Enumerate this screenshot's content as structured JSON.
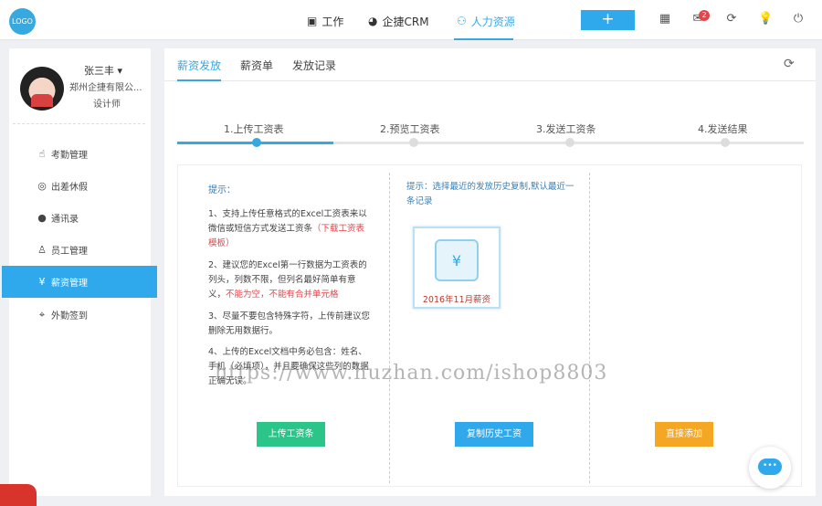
{
  "header": {
    "logo": "LOGO",
    "nav": [
      {
        "label": "工作",
        "icon": "briefcase-icon"
      },
      {
        "label": "企捷CRM",
        "icon": "pie-chart-icon"
      },
      {
        "label": "人力资源",
        "icon": "people-icon"
      }
    ],
    "add_label": "+",
    "badge_count": "2",
    "accent": "#2fa8ec"
  },
  "sidebar": {
    "user_name": "张三丰 ▾",
    "company": "郑州企捷有限公...",
    "position": "设计师",
    "items": [
      {
        "label": "考勤管理",
        "icon": "hand-icon"
      },
      {
        "label": "出差休假",
        "icon": "location-icon"
      },
      {
        "label": "通讯录",
        "icon": "contact-icon"
      },
      {
        "label": "员工管理",
        "icon": "staff-icon"
      },
      {
        "label": "薪资管理",
        "icon": "yen-icon"
      },
      {
        "label": "外勤签到",
        "icon": "pin-icon"
      }
    ]
  },
  "tabs": [
    "薪资发放",
    "薪资单",
    "发放记录"
  ],
  "steps": [
    "1.上传工资表",
    "2.预览工资表",
    "3.发送工资条",
    "4.发送结果"
  ],
  "tips": {
    "title": "提示：",
    "t1": "1、支持上传任意格式的Excel工资表来以微信或短信方式发送工资条",
    "t1_link": "（下载工资表模板）",
    "t2": "2、建议您的Excel第一行数据为工资表的列头，列数不限，但列名最好简单有意义，",
    "t2_warn": "不能为空，不能有合并单元格",
    "t3": "3、尽量不要包含特殊字符，上传前建议您删除无用数据行。",
    "t4": "4、上传的Excel文档中务必包含：姓名、手机（必填项），并且要确保这些列的数据正确无误。",
    "history_tip": "提示：选择最近的发放历史复制,默认最近一条记录"
  },
  "card_label": "2016年11月薪资",
  "card_icon": "¥",
  "buttons": {
    "upload": "上传工资条",
    "copy_history": "复制历史工资",
    "add_direct": "直接添加"
  },
  "watermark": "https://www.huzhan.com/ishop8803",
  "chat_icon": "chat-icon"
}
